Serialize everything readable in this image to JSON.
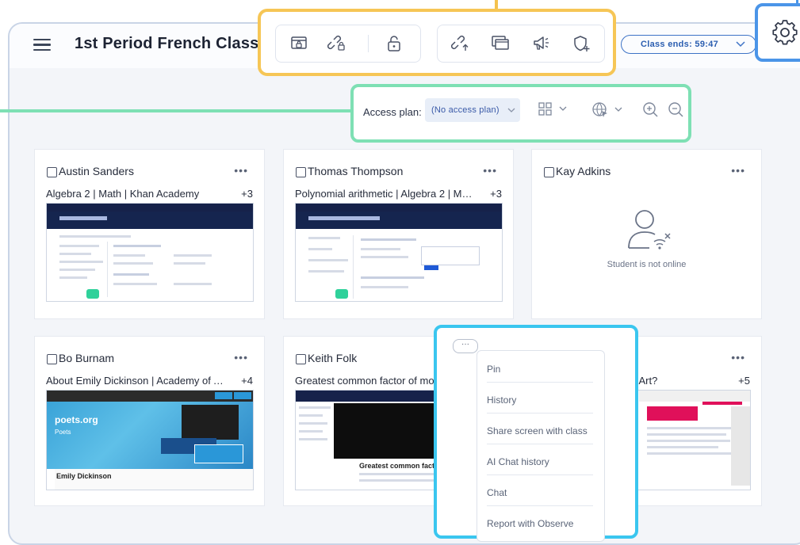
{
  "header": {
    "menu_icon": "hamburger-menu-icon",
    "title": "1st Period French Class",
    "class_ends": "Class ends: 59:47"
  },
  "toolbar": {
    "group1": [
      "lock-screen-icon",
      "lock-tabs-icon",
      "unlock-icon"
    ],
    "group2": [
      "open-link-icon",
      "close-tabs-icon",
      "announce-icon",
      "add-shield-icon"
    ]
  },
  "settings": {
    "icon": "gear-icon"
  },
  "access_bar": {
    "label": "Access plan:",
    "plan_value": "(No access plan)"
  },
  "students": [
    {
      "name": "Austin Sanders",
      "tab": "Algebra 2 | Math | Khan Academy",
      "tab_count": "+3",
      "online": true
    },
    {
      "name": "Thomas Thompson",
      "tab": "Polynomial arithmetic | Algebra 2 | Math | ...",
      "tab_count": "+3",
      "online": true
    },
    {
      "name": "Kay Adkins",
      "online": false,
      "status": "Student is not online"
    },
    {
      "name": "Bo Burnam",
      "tab": "About Emily Dickinson | Academy of Amer...",
      "tab_count": "+4",
      "online": true,
      "thumb_heading": "Emily Dickinson",
      "thumb_logo": "poets.org",
      "thumb_sub": "Poets"
    },
    {
      "name": "Keith Folk",
      "tab": "Greatest common factor of mon",
      "online": true,
      "thumb_heading": "Greatest common factor of ex"
    },
    {
      "name": "",
      "tab": "rn Art?",
      "tab_count": "+5",
      "online": true
    }
  ],
  "context_menu": {
    "dots": "···",
    "items": [
      "Pin",
      "History",
      "Share screen with class",
      "AI Chat history",
      "Chat",
      "Report with Observe"
    ]
  },
  "colors": {
    "toolbar_highlight": "#f6c656",
    "access_highlight": "#7ee0b4",
    "menu_highlight": "#3ac6ef",
    "settings_highlight": "#4b95e8"
  }
}
